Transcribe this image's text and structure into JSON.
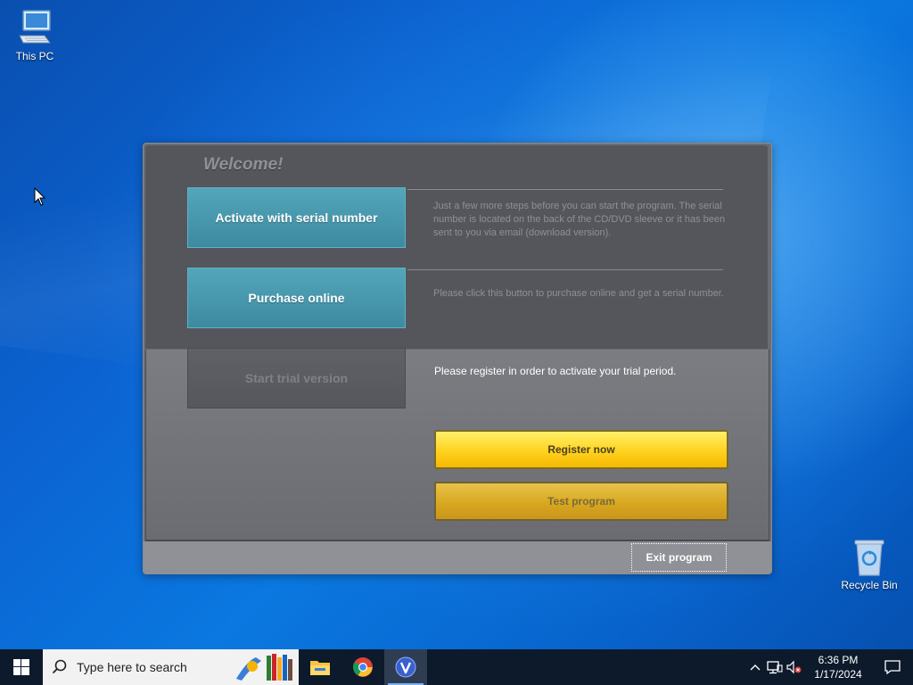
{
  "desktop": {
    "icons": [
      {
        "label": "This PC",
        "icon": "computer-icon"
      },
      {
        "label": "Recycle Bin",
        "icon": "recycle-bin-icon"
      }
    ]
  },
  "dialog": {
    "welcome": "Welcome!",
    "activate_label": "Activate with serial number",
    "activate_desc": "Just a few more steps before you can start the program. The serial number is located on the back of the CD/DVD sleeve or it has been sent to you via email (download version).",
    "purchase_label": "Purchase online",
    "purchase_desc": "Please click this button to purchase online and get a serial number.",
    "trial_label": "Start trial version",
    "trial_desc": "Please register in order to activate your trial period.",
    "register_label": "Register now",
    "test_label": "Test program",
    "exit_label": "Exit program"
  },
  "taskbar": {
    "search_placeholder": "Type here to search",
    "apps": [
      "file-explorer-icon",
      "chrome-icon",
      "v-app-icon"
    ],
    "time": "6:36 PM",
    "date": "1/17/2024"
  },
  "colors": {
    "teal": "#4a9bb0",
    "yellow": "#ffd21f",
    "dialog_dark": "#55565b",
    "taskbar": "#0c1a2b"
  }
}
